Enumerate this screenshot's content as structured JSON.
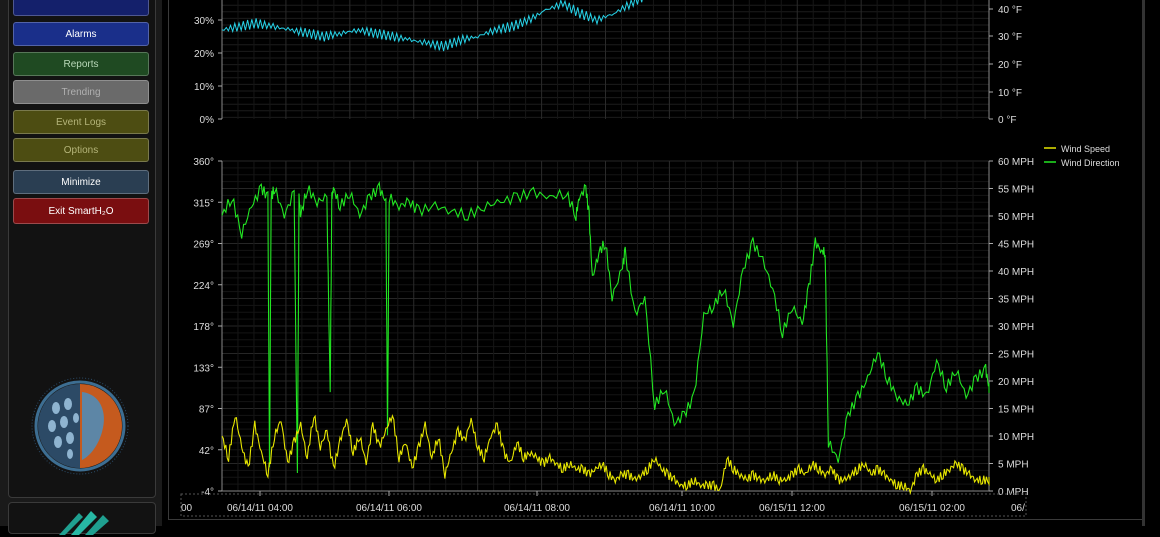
{
  "sidebar": {
    "buttons": [
      {
        "label": "",
        "bg": "#14206b"
      },
      {
        "label": "Alarms",
        "bg": "#1a2f8a"
      },
      {
        "label": "Reports",
        "bg": "#1f4a22"
      },
      {
        "label": "Trending",
        "bg": "#6a6a6a"
      },
      {
        "label": "Event Logs",
        "bg": "#4d4d12"
      },
      {
        "label": "Options",
        "bg": "#4d4d12"
      },
      {
        "label": "Minimize",
        "bg": "#2a3e52"
      },
      {
        "label": "Exit SmartH₂O",
        "bg": "#7a0e10"
      }
    ]
  },
  "chart_data": [
    {
      "type": "line",
      "title": "",
      "y_left_ticks": [
        "30%",
        "20%",
        "10%",
        "0%"
      ],
      "y_right_ticks": [
        "40 °F",
        "30 °F",
        "20 °F",
        "10 °F",
        "0 °F"
      ],
      "series": [
        {
          "color": "#27d3e8",
          "x_hours": [
            0,
            2,
            4,
            6,
            8,
            10,
            12,
            14,
            16,
            18,
            20,
            22,
            24,
            26,
            28,
            30,
            32,
            34,
            36,
            38,
            40,
            42,
            44,
            46,
            48,
            50,
            52,
            54,
            56,
            58,
            60,
            62,
            64,
            66,
            68,
            70,
            72,
            74,
            76,
            78,
            80,
            82,
            84,
            86,
            88,
            90
          ],
          "values": [
            27,
            28,
            29,
            28,
            27,
            26,
            25,
            26,
            27,
            26,
            25,
            24,
            23,
            22,
            24,
            25,
            27,
            28,
            30,
            33,
            35,
            32,
            30,
            32,
            35,
            38,
            40,
            42,
            45,
            47,
            48,
            49,
            50,
            51,
            52,
            53,
            52,
            51,
            50,
            52,
            53,
            54,
            55,
            56,
            55,
            56
          ]
        }
      ]
    },
    {
      "type": "line",
      "y_left_ticks": [
        "360°",
        "315°",
        "269°",
        "224°",
        "178°",
        "133°",
        "87°",
        "42°",
        "-4°"
      ],
      "y_right_ticks": [
        "60 MPH",
        "55 MPH",
        "50 MPH",
        "45 MPH",
        "40 MPH",
        "35 MPH",
        "30 MPH",
        "25 MPH",
        "20 MPH",
        "15 MPH",
        "10 MPH",
        "5 MPH",
        "0 MPH"
      ],
      "x_ticks": [
        "06/14/11 04:00",
        "06/14/11 06:00",
        "06/14/11 08:00",
        "06/14/11 10:00",
        "06/15/11 12:00",
        "06/15/11 02:00"
      ],
      "x_tick_edge_left": "00",
      "x_tick_edge_right": "06/",
      "legend": [
        "Wind Speed",
        "Wind Direction"
      ],
      "series": [
        {
          "name": "Wind Speed",
          "color": "#e6e600",
          "x_hours": [
            0,
            0.2,
            0.4,
            0.6,
            0.8,
            1.0,
            1.2,
            1.4,
            1.6,
            1.8,
            2.0,
            2.2,
            2.4,
            2.6,
            2.8,
            3.0,
            3.2,
            3.4,
            3.6,
            3.8,
            4.0,
            4.2,
            4.4,
            4.6,
            4.8,
            5.0,
            5.2,
            5.4,
            5.6,
            5.8,
            6.0,
            6.2,
            6.4,
            6.6,
            6.8,
            7.0,
            7.2,
            7.4,
            7.6,
            7.8,
            8.0,
            8.2,
            8.4,
            8.6,
            8.8,
            9.0,
            9.2,
            9.4,
            9.6,
            9.8,
            10.0,
            10.2,
            10.4,
            10.6,
            10.8,
            11.0,
            11.2,
            11.4,
            11.6,
            11.8,
            12.0,
            12.2,
            12.4,
            12.6,
            12.8,
            13.0,
            13.2,
            13.4,
            13.6,
            13.8,
            14.0,
            14.2,
            14.4,
            14.6,
            14.8,
            15.0,
            15.2,
            15.4,
            15.6,
            15.8,
            16.0,
            16.2,
            16.4,
            16.6,
            16.8,
            17.0,
            17.2,
            17.4,
            17.6,
            17.8,
            18.0,
            18.2,
            18.4,
            18.6,
            18.8,
            19.0,
            19.2,
            19.4,
            19.6,
            19.8,
            20.0,
            20.2,
            20.4,
            20.6,
            20.8,
            21.0,
            21.2,
            21.4,
            21.6,
            21.8,
            22.0,
            22.2,
            22.4,
            22.6,
            22.8,
            23.0,
            23.2,
            23.4
          ],
          "values": [
            10,
            6,
            14,
            8,
            4,
            12,
            7,
            3,
            10,
            13,
            5,
            9,
            12,
            6,
            14,
            8,
            11,
            4,
            9,
            13,
            7,
            10,
            5,
            12,
            8,
            11,
            14,
            6,
            9,
            4,
            8,
            12,
            6,
            10,
            3,
            7,
            11,
            9,
            13,
            8,
            6,
            10,
            12,
            7,
            5,
            9,
            6,
            7,
            6,
            5,
            6,
            5,
            4,
            5,
            4,
            4,
            3,
            4,
            5,
            3,
            2,
            3,
            3,
            2,
            3,
            4,
            6,
            4,
            3,
            2,
            1,
            1,
            2,
            1,
            1,
            1,
            0,
            6,
            4,
            3,
            2,
            3,
            2,
            2,
            3,
            2,
            2,
            3,
            4,
            3,
            5,
            4,
            3,
            4,
            2,
            2,
            3,
            4,
            5,
            3,
            4,
            3,
            2,
            1,
            1,
            0,
            3,
            4,
            3,
            2,
            3,
            4,
            5,
            4,
            3,
            2,
            2,
            2
          ]
        },
        {
          "name": "Wind Direction",
          "color": "#22e622",
          "x_hours": [
            0,
            0.3,
            0.6,
            0.9,
            1.2,
            1.4,
            1.45,
            1.5,
            1.6,
            1.9,
            2.2,
            2.3,
            2.35,
            2.4,
            2.6,
            2.9,
            3.2,
            3.3,
            3.35,
            3.4,
            3.6,
            3.9,
            4.2,
            4.5,
            4.8,
            5.0,
            5.05,
            5.1,
            5.4,
            5.7,
            6.0,
            6.5,
            7.0,
            7.5,
            8.0,
            8.5,
            9.0,
            9.5,
            10.0,
            10.5,
            10.8,
            10.9,
            11.1,
            11.2,
            11.3,
            11.5,
            11.7,
            11.9,
            12.2,
            12.3,
            12.6,
            12.9,
            13.2,
            13.5,
            13.8,
            14.1,
            14.4,
            14.7,
            15.0,
            15.3,
            15.6,
            15.9,
            16.2,
            16.5,
            16.8,
            17.1,
            17.4,
            17.7,
            17.9,
            18.1,
            18.3,
            18.4,
            18.5,
            18.8,
            19.1,
            19.4,
            19.7,
            20.0,
            20.3,
            20.6,
            20.9,
            21.2,
            21.5,
            21.8,
            22.1,
            22.4,
            22.7,
            23.0,
            23.3,
            23.4
          ],
          "values": [
            300,
            320,
            280,
            310,
            330,
            320,
            20,
            320,
            330,
            300,
            325,
            10,
            320,
            300,
            330,
            315,
            320,
            100,
            320,
            330,
            310,
            325,
            300,
            320,
            330,
            315,
            60,
            320,
            310,
            315,
            305,
            310,
            305,
            300,
            310,
            315,
            320,
            325,
            320,
            325,
            300,
            320,
            330,
            300,
            230,
            260,
            270,
            210,
            240,
            260,
            190,
            210,
            90,
            110,
            70,
            80,
            100,
            190,
            200,
            220,
            180,
            240,
            270,
            250,
            220,
            170,
            200,
            180,
            220,
            270,
            260,
            260,
            50,
            30,
            80,
            100,
            120,
            150,
            120,
            100,
            90,
            110,
            100,
            140,
            110,
            130,
            100,
            120,
            130,
            110
          ]
        }
      ]
    }
  ]
}
